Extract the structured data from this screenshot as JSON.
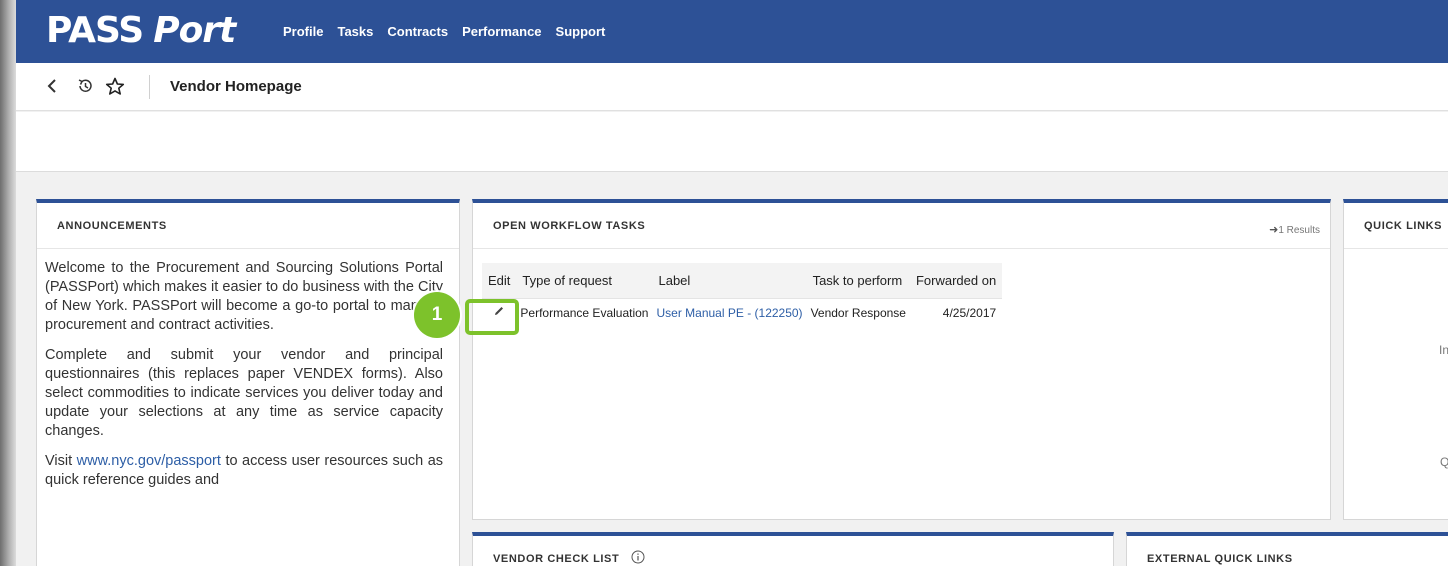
{
  "header": {
    "logo_pass": "PASS",
    "logo_port": "Port",
    "nav": [
      "Profile",
      "Tasks",
      "Contracts",
      "Performance",
      "Support"
    ]
  },
  "subbar": {
    "back_icon": "chevron-left-icon",
    "history_icon": "history-icon",
    "star_icon": "star-icon",
    "title": "Vendor Homepage"
  },
  "announcements": {
    "heading": "ANNOUNCEMENTS",
    "para1": "Welcome to the Procurement and Sourcing Solutions Portal (PASSPort) which makes it easier to do business with the City of New York. PASSPort will become a go-to portal to manage procurement and contract activities.",
    "para2": "Complete and submit your vendor and principal questionnaires (this replaces paper VENDEX forms). Also select commodities to indicate services you deliver today and update your selections at any time as service capacity changes.",
    "para3_prefix": "Visit",
    "para3_link": "www.nyc.gov/passport",
    "para3_suffix": "to access user resources such as quick reference guides and"
  },
  "workflow": {
    "heading": "OPEN WORKFLOW TASKS",
    "results": "1 Results",
    "columns": {
      "edit": "Edit",
      "type": "Type of request",
      "label": "Label",
      "task": "Task to perform",
      "forwarded": "Forwarded on"
    },
    "rows": [
      {
        "type": "Performance Evaluation",
        "label": "User Manual PE - (122250)",
        "task": "Vendor Response",
        "forwarded": "4/25/2017"
      }
    ]
  },
  "callout": {
    "number": "1",
    "color": "#7dc22b"
  },
  "quick_links": {
    "heading": "QUICK LINKS",
    "fragment_1": "In",
    "fragment_2": "Q"
  },
  "vendor_check_list": {
    "heading": "VENDOR CHECK LIST",
    "info_icon": "info-icon"
  },
  "external_quick_links": {
    "heading": "EXTERNAL QUICK LINKS"
  },
  "colors": {
    "brand_blue": "#2d5196",
    "link_blue": "#2d5ea6",
    "callout_green": "#7dc22b"
  }
}
